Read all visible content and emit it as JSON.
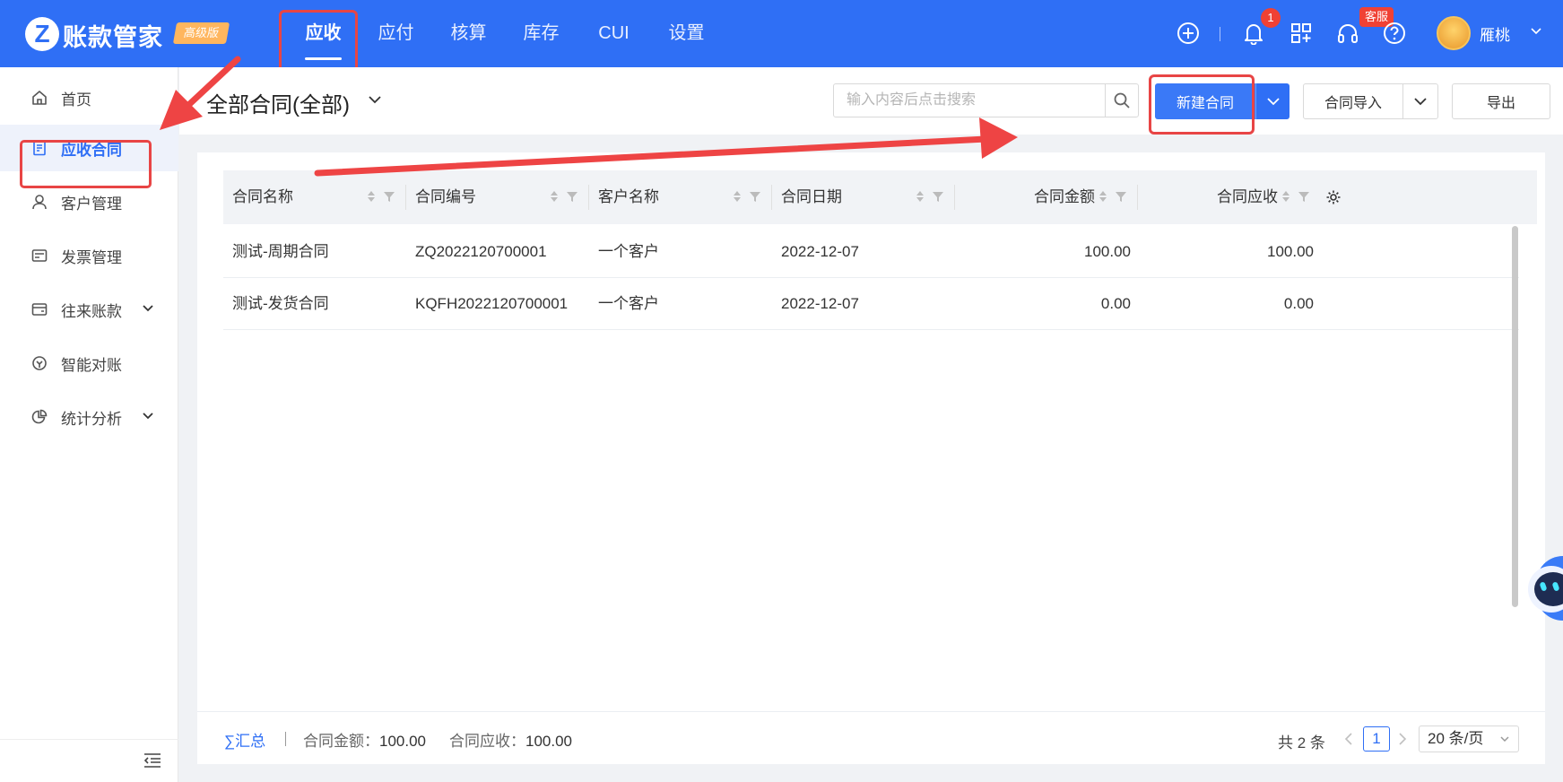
{
  "app": {
    "logo_letter": "Z",
    "name": "账款管家",
    "edition": "高级版"
  },
  "topnav": [
    {
      "label": "应收",
      "active": true
    },
    {
      "label": "应付",
      "active": false
    },
    {
      "label": "核算",
      "active": false
    },
    {
      "label": "库存",
      "active": false
    },
    {
      "label": "CUI",
      "active": false
    },
    {
      "label": "设置",
      "active": false
    }
  ],
  "topbar": {
    "notification_count": "1",
    "service_badge": "客服",
    "user_name": "雁桃",
    "icons": [
      "add-circle-icon",
      "bell-icon",
      "apps-icon",
      "headset-icon",
      "help-icon"
    ]
  },
  "sidebar": {
    "items": [
      {
        "label": "首页",
        "icon": "home-icon",
        "active": false,
        "expandable": false
      },
      {
        "label": "应收合同",
        "icon": "contract-icon",
        "active": true,
        "expandable": false
      },
      {
        "label": "客户管理",
        "icon": "user-icon",
        "active": false,
        "expandable": false
      },
      {
        "label": "发票管理",
        "icon": "invoice-icon",
        "active": false,
        "expandable": false
      },
      {
        "label": "往来账款",
        "icon": "ledger-icon",
        "active": false,
        "expandable": true
      },
      {
        "label": "智能对账",
        "icon": "reconcile-icon",
        "active": false,
        "expandable": false
      },
      {
        "label": "统计分析",
        "icon": "pie-chart-icon",
        "active": false,
        "expandable": true
      }
    ]
  },
  "header": {
    "title": "全部合同(全部)",
    "search_placeholder": "输入内容后点击搜索",
    "new_button": "新建合同",
    "import_button": "合同导入",
    "export_button": "导出"
  },
  "table": {
    "columns": [
      "合同名称",
      "合同编号",
      "客户名称",
      "合同日期",
      "合同金额",
      "合同应收"
    ],
    "rows": [
      [
        "测试-周期合同",
        "ZQ2022120700001",
        "一个客户",
        "2022-12-07",
        "100.00",
        "100.00"
      ],
      [
        "测试-发货合同",
        "KQFH2022120700001",
        "一个客户",
        "2022-12-07",
        "0.00",
        "0.00"
      ]
    ]
  },
  "summary": {
    "label": "∑汇总",
    "amount_label": "合同金额：",
    "amount_value": "100.00",
    "receivable_label": "合同应收：",
    "receivable_value": "100.00"
  },
  "pagination": {
    "total": "共 2 条",
    "current_page": "1",
    "page_size": "20 条/页"
  },
  "colors": {
    "primary": "#2f6ff5",
    "annotation": "#e84545",
    "badge": "#f04134"
  }
}
